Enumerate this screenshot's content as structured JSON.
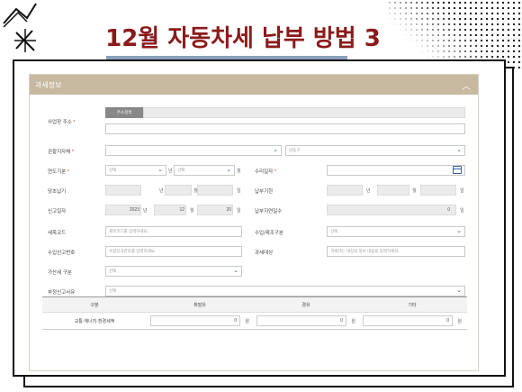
{
  "slide": {
    "title": "12월 자동차세 납부 방법 3"
  },
  "panel": {
    "title": "과세정보"
  },
  "form": {
    "required_mark": "*",
    "unit_year": "년",
    "unit_month": "월",
    "unit_day": "일",
    "business_address": {
      "label": "사업장 주소",
      "button": "주소검색"
    },
    "jurisdiction": {
      "label": "관할지자체",
      "city": "",
      "district": "남동구"
    },
    "year_period": {
      "label": "연도기분",
      "year_value": "선택",
      "year_unit": "년",
      "month_value": "선택",
      "month_unit": "월"
    },
    "acceptance_date": {
      "label": "수리일자"
    },
    "original_due": {
      "label": "당초납기"
    },
    "payment_due": {
      "label": "납부기한"
    },
    "report_date": {
      "label": "신고일자",
      "year": "2023",
      "month": "12",
      "day": "20"
    },
    "late_days": {
      "label": "납부지연일수",
      "value": "0"
    },
    "tax_code": {
      "label": "세목코드",
      "placeholder": "세목코드를 입력하세요."
    },
    "import_type": {
      "label": "수입/제조구분",
      "value": "선택"
    },
    "import_report": {
      "label": "수입신고번호",
      "placeholder": "수입신고번호를 입력하세요."
    },
    "tax_object": {
      "label": "과세대상",
      "placeholder": "과세하는 대상의 정보 내용을 입력하세요."
    },
    "penalty_type": {
      "label": "가산세 구분",
      "value": "선택"
    },
    "fraud_reason": {
      "label": "부정신고사유",
      "value": "선택"
    }
  },
  "table": {
    "headers": [
      "구분",
      "휘발유",
      "경유",
      "기타"
    ],
    "row": {
      "label": "교통·에너지·환경세액",
      "gasoline": "0",
      "diesel": "0",
      "other": "0",
      "unit": "원"
    }
  }
}
